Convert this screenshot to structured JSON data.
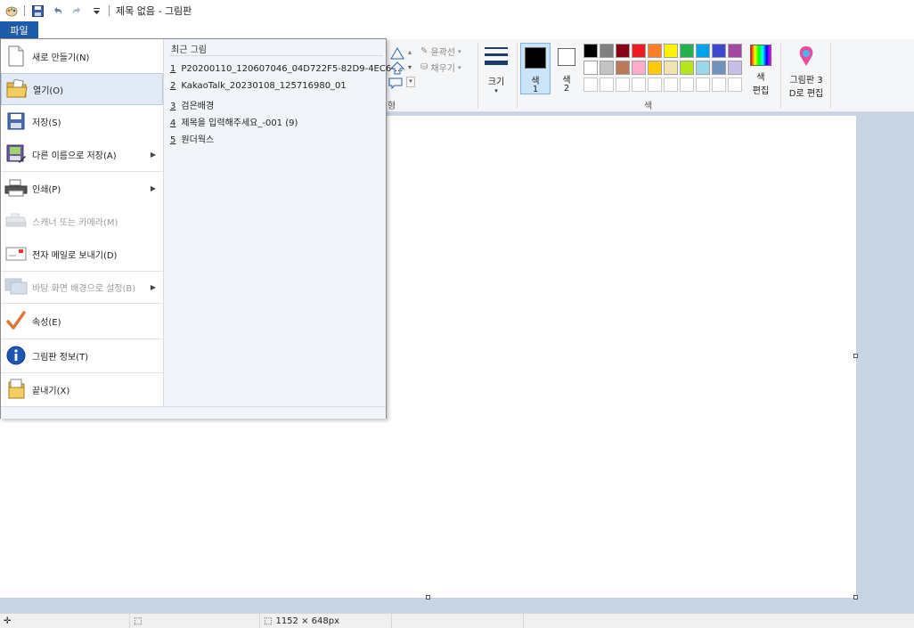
{
  "window": {
    "title": "제목 없음 - 그림판"
  },
  "ribbon": {
    "file_tab": "파일",
    "outline_label": "윤곽선",
    "fill_label": "채우기",
    "size_label": "크기",
    "color1_label": "색",
    "color1_num": "1",
    "color2_label": "색",
    "color2_num": "2",
    "edit_colors_label_1": "색",
    "edit_colors_label_2": "편집",
    "paint3d_label_1": "그림판 3",
    "paint3d_label_2": "D로 편집",
    "shapes_group_label": "형",
    "colors_group_label": "색"
  },
  "palette": {
    "row1": [
      "#000000",
      "#7f7f7f",
      "#880015",
      "#ed1c24",
      "#ff7f27",
      "#fff200",
      "#22b14c",
      "#00a2e8",
      "#3f48cc",
      "#a349a4"
    ],
    "row2": [
      "#ffffff",
      "#c3c3c3",
      "#b97a57",
      "#ffaec9",
      "#ffc90e",
      "#efe4b0",
      "#b5e61d",
      "#99d9ea",
      "#7092be",
      "#c8bfe7"
    ],
    "color1": "#000000",
    "color2": "#ffffff"
  },
  "file_menu": {
    "items": [
      {
        "label": "새로 만들기(N)",
        "icon": "new-document-icon"
      },
      {
        "label": "열기(O)",
        "icon": "open-folder-icon"
      },
      {
        "label": "저장(S)",
        "icon": "save-floppy-icon"
      },
      {
        "label": "다른 이름으로 저장(A)",
        "icon": "save-as-icon"
      },
      {
        "label": "인쇄(P)",
        "icon": "printer-icon"
      },
      {
        "label": "스캐너 또는 카메라(M)",
        "icon": "scanner-icon"
      },
      {
        "label": "전자 메일로 보내기(D)",
        "icon": "email-icon"
      },
      {
        "label": "바탕 화면 배경으로 설정(B)",
        "icon": "desktop-background-icon"
      },
      {
        "label": "속성(E)",
        "icon": "checkmark-icon"
      },
      {
        "label": "그림판 정보(T)",
        "icon": "info-icon"
      },
      {
        "label": "끝내기(X)",
        "icon": "exit-icon"
      }
    ],
    "recent_title": "최근 그림",
    "recent": [
      {
        "num": "1",
        "name": "P20200110_120607046_04D722F5-82D9-4EC6-..."
      },
      {
        "num": "2",
        "name": "KakaoTalk_20230108_125716980_01"
      },
      {
        "num": "3",
        "name": "검은배경"
      },
      {
        "num": "4",
        "name": "제목을 입력해주세요_-001 (9)"
      },
      {
        "num": "5",
        "name": "원더웍스"
      }
    ]
  },
  "status": {
    "dimensions": "1152 × 648px"
  }
}
